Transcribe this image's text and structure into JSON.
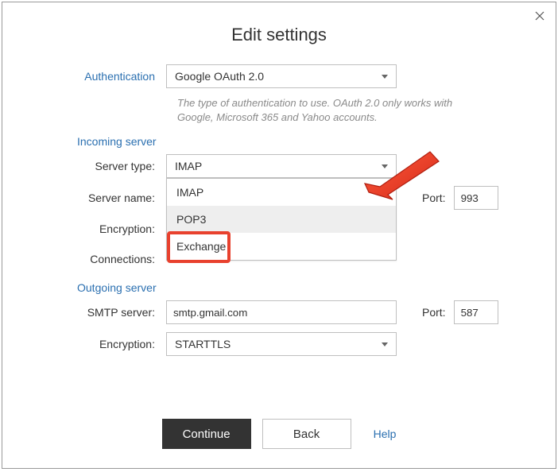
{
  "window": {
    "title": "Edit settings"
  },
  "auth": {
    "label": "Authentication",
    "value": "Google OAuth 2.0",
    "hint": "The type of authentication to use. OAuth 2.0 only works with Google, Microsoft 365 and Yahoo accounts."
  },
  "incoming": {
    "section": "Incoming server",
    "server_type": {
      "label": "Server type:",
      "value": "IMAP",
      "options": [
        "IMAP",
        "POP3",
        "Exchange"
      ]
    },
    "server_name": {
      "label": "Server name:",
      "value": ""
    },
    "encryption": {
      "label": "Encryption:",
      "value": ""
    },
    "connections": {
      "label": "Connections:",
      "value": ""
    },
    "port": {
      "label": "Port:",
      "value": "993"
    }
  },
  "outgoing": {
    "section": "Outgoing server",
    "smtp": {
      "label": "SMTP server:",
      "value": "smtp.gmail.com"
    },
    "encryption": {
      "label": "Encryption:",
      "value": "STARTTLS"
    },
    "port": {
      "label": "Port:",
      "value": "587"
    }
  },
  "footer": {
    "continue": "Continue",
    "back": "Back",
    "help": "Help"
  }
}
